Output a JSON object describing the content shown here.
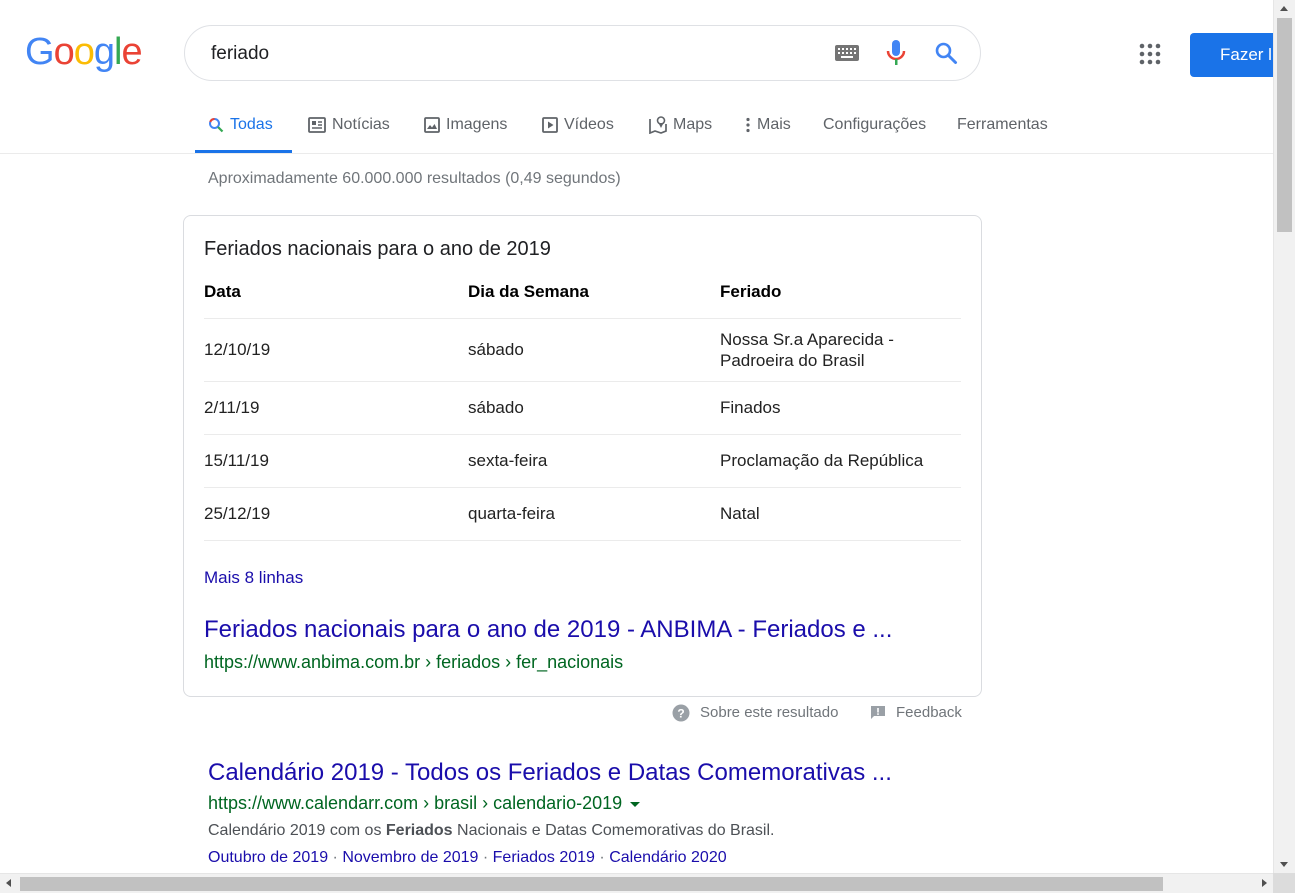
{
  "logo": {
    "letters": [
      "G",
      "o",
      "o",
      "g",
      "l",
      "e"
    ],
    "colors": [
      "#4285f4",
      "#ea4335",
      "#fbbc05",
      "#4285f4",
      "#34a853",
      "#ea4335"
    ]
  },
  "search": {
    "query": "feriado"
  },
  "header": {
    "signin_label": "Fazer l"
  },
  "tabs": [
    {
      "label": "Todas",
      "icon": "search-icon"
    },
    {
      "label": "Notícias",
      "icon": "news-icon"
    },
    {
      "label": "Imagens",
      "icon": "image-icon"
    },
    {
      "label": "Vídeos",
      "icon": "video-icon"
    },
    {
      "label": "Maps",
      "icon": "map-icon"
    },
    {
      "label": "Mais",
      "icon": "more-vert-icon"
    },
    {
      "label": "Configurações"
    },
    {
      "label": "Ferramentas"
    }
  ],
  "stats": "Aproximadamente 60.000.000 resultados (0,49 segundos)",
  "featured": {
    "title": "Feriados nacionais para o ano de 2019",
    "columns": [
      "Data",
      "Dia da Semana",
      "Feriado"
    ],
    "rows": [
      {
        "date": "12/10/19",
        "weekday": "sábado",
        "holiday_line1": "Nossa Sr.a Aparecida -",
        "holiday_line2": "Padroeira do Brasil"
      },
      {
        "date": "2/11/19",
        "weekday": "sábado",
        "holiday": "Finados"
      },
      {
        "date": "15/11/19",
        "weekday": "sexta-feira",
        "holiday": "Proclamação da República"
      },
      {
        "date": "25/12/19",
        "weekday": "quarta-feira",
        "holiday": "Natal"
      }
    ],
    "more_rows": "Mais 8 linhas",
    "link_title": "Feriados nacionais para o ano de 2019 - ANBIMA - Feriados e ...",
    "link_url": "https://www.anbima.com.br › feriados › fer_nacionais"
  },
  "about": {
    "about_label": "Sobre este resultado",
    "feedback_label": "Feedback"
  },
  "result": {
    "title": "Calendário 2019 - Todos os Feriados e Datas Comemorativas ...",
    "url": "https://www.calendarr.com › brasil › calendario-2019",
    "snippet_before": "Calendário 2019 com os ",
    "snippet_bold": "Feriados",
    "snippet_after": " Nacionais e Datas Comemorativas do Brasil.",
    "sitelinks": [
      "Outubro de 2019",
      "Novembro de 2019",
      "Feriados 2019",
      "Calendário 2020"
    ],
    "separator": "·"
  }
}
